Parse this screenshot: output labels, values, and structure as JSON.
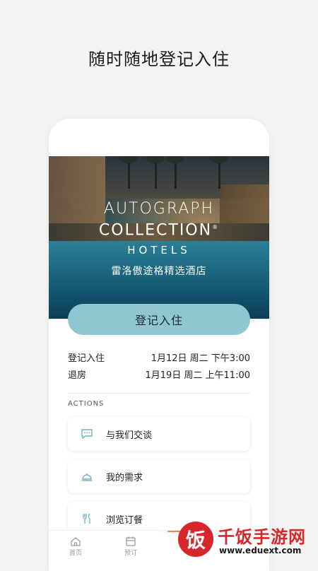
{
  "headline": "随时随地登记入住",
  "hotel": {
    "brand_line1": "AUTOGRAPH",
    "brand_line2": "COLLECTION",
    "brand_registered": "®",
    "brand_line3": "HOTELS",
    "name": "雷洛傲途格精选酒店"
  },
  "checkin_button": "登记入住",
  "stay": {
    "checkin_label": "登记入住",
    "checkin_value": "1月12日 周二 下午3:00",
    "checkout_label": "退房",
    "checkout_value": "1月19日 周二 上午11:00"
  },
  "actions_header": "ACTIONS",
  "actions": [
    {
      "label": "与我们交谈",
      "icon": "chat-bubble-icon"
    },
    {
      "label": "我的需求",
      "icon": "service-bell-icon"
    },
    {
      "label": "浏览订餐",
      "icon": "fork-knife-icon"
    }
  ],
  "tabs": [
    {
      "label": "首页",
      "icon": "home-icon"
    },
    {
      "label": "预订",
      "icon": "calendar-icon"
    },
    {
      "label": "",
      "icon": "tab-icon"
    },
    {
      "label": "",
      "icon": "tab-icon"
    }
  ],
  "accent_color": "#8ec6d1",
  "watermark": {
    "logo": "饭",
    "title": "千饭手游网",
    "url": "www.eduext.com"
  }
}
